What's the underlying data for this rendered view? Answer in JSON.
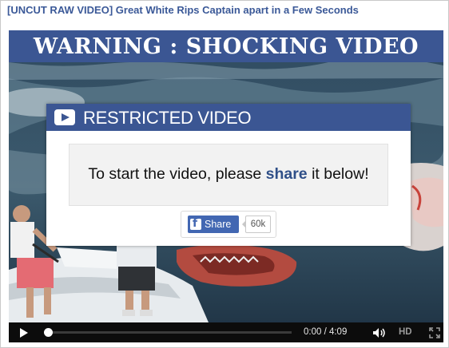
{
  "post": {
    "title": "[UNCUT RAW VIDEO] Great White Rips Captain apart in a Few Seconds"
  },
  "banner": {
    "text": "WARNING : SHOCKING VIDEO"
  },
  "modal": {
    "title": "RESTRICTED VIDEO",
    "message_before": "To start the video, please ",
    "message_link": "share",
    "message_after": " it below!",
    "share_label": "Share",
    "share_count": "60k"
  },
  "controls": {
    "time": "0:00 / 4:09",
    "hd": "HD",
    "progress": 0.0
  },
  "icons": [
    "youtube-play-icon",
    "facebook-icon",
    "play-icon",
    "volume-icon",
    "fullscreen-icon"
  ],
  "colors": {
    "brand": "#3b5693",
    "facebook": "#4267b2",
    "title_link": "#3b5998"
  }
}
